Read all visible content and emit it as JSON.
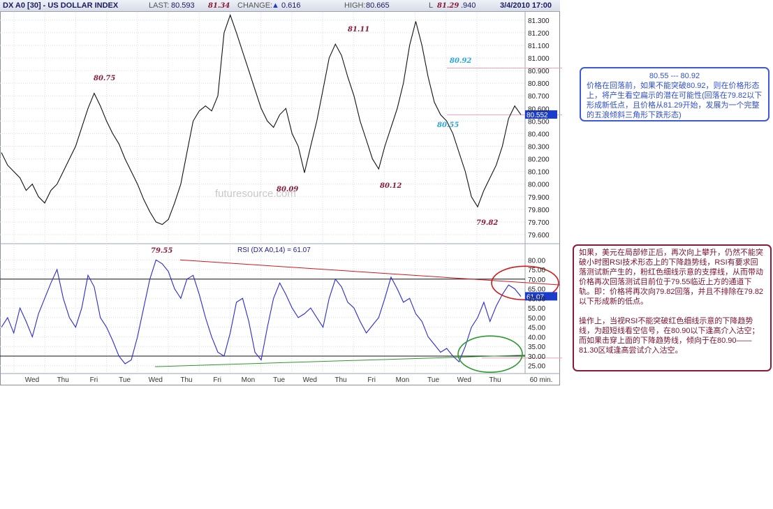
{
  "header": {
    "symbol": "DX A0 [30] - US DOLLAR INDEX",
    "last_label": "LAST:",
    "last_value": "80.593",
    "change_label": "CHANGE:",
    "change_value": "0.616",
    "high_label": "HIGH:",
    "high_value": "80.665",
    "low_label": "L",
    "low_value": ".940",
    "date": "3/4/2010 17:00",
    "up_color": "#1a3cc8"
  },
  "watermark": "futuresource.com",
  "chart_data": [
    {
      "type": "line",
      "title": "DX A0 [30] - US DOLLAR INDEX",
      "y_ticks": [
        "81.300",
        "81.200",
        "81.100",
        "81.000",
        "80.900",
        "80.800",
        "80.700",
        "80.600",
        "80.500",
        "80.400",
        "80.300",
        "80.200",
        "80.100",
        "80.000",
        "79.900",
        "79.800",
        "79.700",
        "79.600"
      ],
      "ylim": [
        79.55,
        81.36
      ],
      "x_categories": [
        "Wed",
        "Thu",
        "Fri",
        "Tue",
        "Wed",
        "Thu",
        "Fri",
        "Mon",
        "Tue",
        "Wed",
        "Thu",
        "Fri",
        "Mon",
        "Tue",
        "Wed",
        "Thu"
      ],
      "x_unit": "60 min.",
      "last_price_tag": "80.552",
      "series": [
        {
          "values": [
            80.25,
            80.15,
            80.1,
            80.05,
            79.95,
            80.0,
            79.9,
            79.85,
            79.95,
            80.0,
            80.1,
            80.2,
            80.3,
            80.45,
            80.6,
            80.72,
            80.62,
            80.5,
            80.4,
            80.32,
            80.2,
            80.1,
            80.0,
            79.88,
            79.78,
            79.7,
            79.68,
            79.72,
            79.85,
            80.0,
            80.25,
            80.5,
            80.58,
            80.62,
            80.58,
            80.7,
            81.2,
            81.34,
            81.2,
            81.05,
            80.9,
            80.75,
            80.6,
            80.5,
            80.45,
            80.55,
            80.6,
            80.4,
            80.3,
            80.09,
            80.3,
            80.5,
            80.75,
            81.0,
            81.11,
            81.02,
            80.85,
            80.7,
            80.5,
            80.35,
            80.2,
            80.12,
            80.3,
            80.45,
            80.6,
            80.8,
            81.1,
            81.29,
            81.1,
            80.85,
            80.65,
            80.55,
            80.5,
            80.4,
            80.25,
            80.1,
            79.9,
            79.82,
            79.95,
            80.05,
            80.15,
            80.3,
            80.52,
            80.62,
            80.55
          ]
        }
      ],
      "annotations": [
        "80.75",
        "81.34",
        "81.11",
        "81.29",
        "80.92",
        "80.55",
        "80.09",
        "80.12",
        "79.82",
        "79.55"
      ],
      "support_resistance": {
        "upper": 80.92,
        "lower": 80.55
      }
    },
    {
      "type": "line",
      "title": "RSI (DX A0,14) = 61.07",
      "y_ticks": [
        "80.00",
        "75.00",
        "70.00",
        "65.00",
        "60.00",
        "55.00",
        "50.00",
        "45.00",
        "40.00",
        "35.00",
        "30.00",
        "25.00"
      ],
      "ylim": [
        22,
        83
      ],
      "reference_lines": [
        70,
        30
      ],
      "current_value_tag": "61.07",
      "series": [
        {
          "values": [
            45,
            50,
            42,
            55,
            48,
            40,
            52,
            60,
            68,
            75,
            60,
            50,
            45,
            55,
            72,
            66,
            50,
            45,
            38,
            30,
            26,
            28,
            40,
            55,
            70,
            80,
            78,
            74,
            65,
            60,
            70,
            72,
            62,
            50,
            40,
            32,
            30,
            42,
            58,
            60,
            48,
            32,
            28,
            45,
            60,
            68,
            62,
            55,
            50,
            52,
            55,
            50,
            45,
            60,
            70,
            66,
            58,
            55,
            48,
            42,
            46,
            50,
            60,
            71,
            65,
            58,
            60,
            52,
            48,
            40,
            36,
            32,
            34,
            30,
            27,
            35,
            45,
            50,
            58,
            48,
            56,
            62,
            67,
            65,
            61
          ]
        }
      ]
    }
  ],
  "notes": {
    "blue": {
      "heading": "80.55 --- 80.92",
      "body": "价格在回落前，如果不能突破80.92，则在价格形态上，将产生看空扁示的潜在可能性(回落在79.82以下形成新低点，且价格从81.29开始，发展为一个完整的五浪倾斜三角形下跌形态)"
    },
    "red": {
      "para1": "如果，美元在局部修正后，再次向上攀升，仍然不能突破小时图RSI技术形态上的下降趋势线，RSI有要求回落测试新产生的，粉红色细线示意的支撑线，从而带动价格再次回落测试目前位于79.55临近上方的通道下轨。即：价格将再次向79.82回落，并且不排除在79.82以下形成新的低点。",
      "para2": "操作上，当视RSI不能突破红色细线示意的下降趋势线，为超短线看空信号，在80.90以下逢高介入沽空；",
      "para3": "而如果击穿上面的下降趋势线，倾向于在80.90——81.30区域逢高尝试介入沽空。"
    }
  },
  "colors": {
    "price_line": "#111111",
    "rsi_line": "#2a2ad8",
    "annotation_price": "#8b1a3a",
    "annotation_cyan": "#2aa6d6",
    "trend_red": "#d01818",
    "trend_green": "#2a9a2a",
    "pink_line": "#f0a0b8"
  }
}
